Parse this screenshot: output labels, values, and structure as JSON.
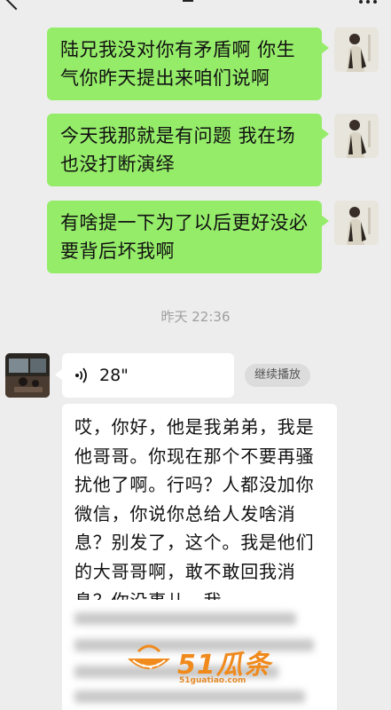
{
  "header": {
    "back_icon": "chevron-left-icon",
    "more_icon": "more-dots-icon"
  },
  "colors": {
    "sent_bubble": "#95ec69",
    "received_bubble": "#ffffff",
    "background": "#ededed",
    "watermark": "#f08a1d"
  },
  "messages_sent": [
    {
      "text": "陆兄我没对你有矛盾啊 你生气你昨天提出来咱们说啊"
    },
    {
      "text": "今天我那就是有问题 我在场也没打断演绎"
    },
    {
      "text": "有啥提一下为了以后更好没必要背后坏我啊"
    }
  ],
  "timestamp": "昨天 22:36",
  "voice_message": {
    "icon": "voice-wave-icon",
    "duration": "28\""
  },
  "continue_play_label": "继续播放",
  "transcript": "哎，你好，他是我弟弟，我是他哥哥。你现在那个不要再骚扰他了啊。行吗？人都没加你微信，你说你总给人发啥消息？别发了，这个。我是他们的大哥哥啊，敢不敢回我消息？你没事儿，我",
  "watermark": {
    "brand": "51瓜条",
    "domain": "51guatiao.com"
  }
}
